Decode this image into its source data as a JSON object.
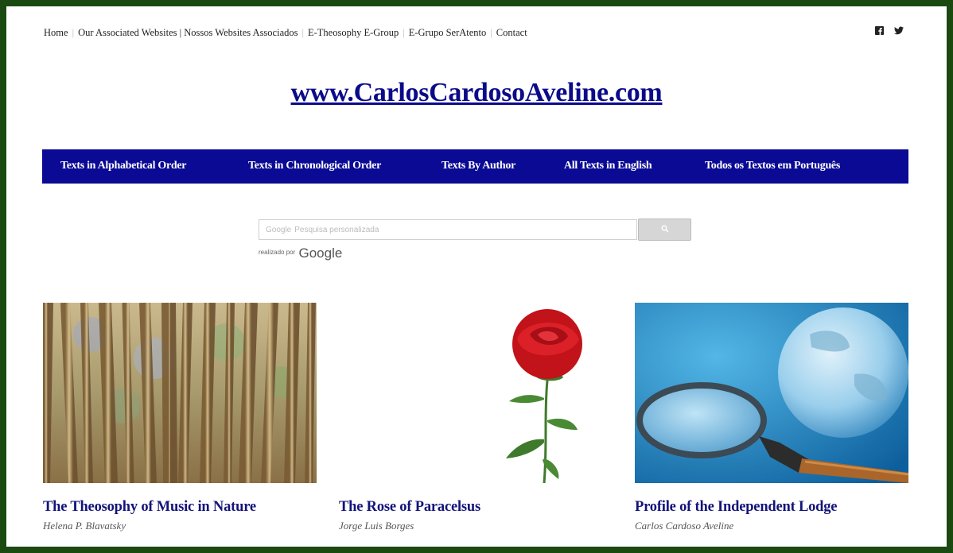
{
  "topnav": {
    "items": [
      "Home",
      "Our Associated Websites | Nossos Websites Associados",
      "E-Theosophy E-Group",
      "E-Grupo SerAtento",
      "Contact"
    ]
  },
  "social": {
    "icons": [
      "facebook-icon",
      "twitter-icon"
    ]
  },
  "site_title": "www.CarlosCardosoAveline.com",
  "mainnav": {
    "items": [
      "Texts in Alphabetical Order",
      "Texts in Chronological Order",
      "Texts By Author",
      "All Texts in English",
      "Todos os Textos em Português"
    ]
  },
  "search": {
    "google_label": "Google",
    "placeholder": "Pesquisa personalizada",
    "powered_prefix": "realizado por",
    "powered_brand": "Google",
    "button_icon": "search-icon"
  },
  "cards": [
    {
      "title": "The Theosophy of Music in Nature",
      "author": "Helena P. Blavatsky"
    },
    {
      "title": "The Rose of Paracelsus",
      "author": "Jorge Luis Borges"
    },
    {
      "title": "Profile of the Independent Lodge",
      "author": "Carlos Cardoso Aveline"
    }
  ],
  "colors": {
    "frame": "#1a4a12",
    "nav_bg": "#0a0a94",
    "title": "#0b0b8a",
    "card_title": "#14147a"
  }
}
